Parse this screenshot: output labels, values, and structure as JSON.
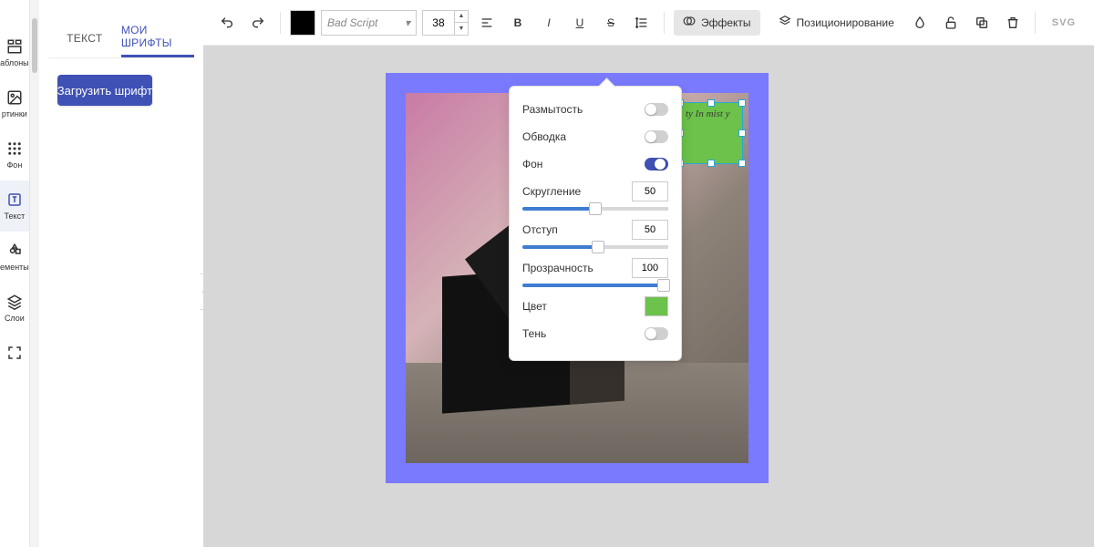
{
  "rail": {
    "items": [
      {
        "label": "аблоны",
        "icon": "templates-icon"
      },
      {
        "label": "ртинки",
        "icon": "images-icon"
      },
      {
        "label": "Фон",
        "icon": "background-icon"
      },
      {
        "label": "Текст",
        "icon": "text-icon",
        "active": true
      },
      {
        "label": "ементы",
        "icon": "elements-icon"
      },
      {
        "label": "Слои",
        "icon": "layers-icon"
      },
      {
        "label": "",
        "icon": "fullscreen-icon"
      }
    ]
  },
  "panel": {
    "tabs": {
      "text_tab": "ТЕКСТ",
      "fonts_tab": "МОИ ШРИФТЫ",
      "active": "fonts_tab"
    },
    "upload_btn": "Загрузить шрифт"
  },
  "toolbar": {
    "font_name": "Bad Script",
    "font_size": "38",
    "color": "#000000",
    "effects_btn": "Эффекты",
    "position_btn": "Позиционирование",
    "svg_btn": "SVG"
  },
  "effects_popover": {
    "blur": {
      "label": "Размытость",
      "on": false
    },
    "stroke": {
      "label": "Обводка",
      "on": false
    },
    "bg": {
      "label": "Фон",
      "on": true
    },
    "radius": {
      "label": "Скругление",
      "value": "50",
      "pos": 50
    },
    "padding": {
      "label": "Отступ",
      "value": "50",
      "pos": 52
    },
    "opacity": {
      "label": "Прозрачность",
      "value": "100",
      "pos": 100
    },
    "color": {
      "label": "Цвет",
      "value": "#6cc24a"
    },
    "shadow": {
      "label": "Тень",
      "on": false
    }
  },
  "canvas": {
    "selection_text": "ty In\nmist\ny"
  }
}
